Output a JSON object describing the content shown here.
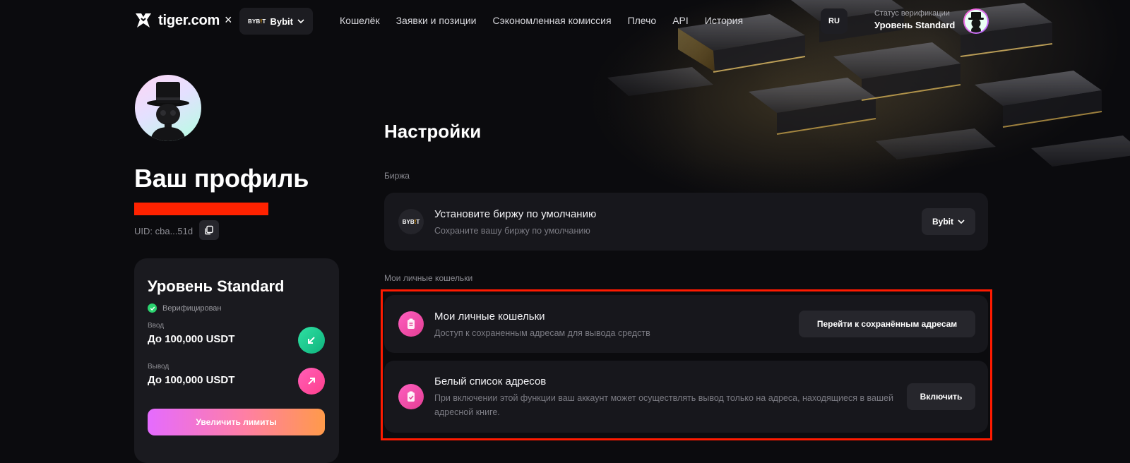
{
  "header": {
    "logo_text": "tiger.com",
    "separator": "×",
    "exchange": {
      "badge": "BYB!T",
      "label": "Bybit"
    },
    "nav": [
      "Кошелёк",
      "Заявки и позиции",
      "Сэкономленная комиссия",
      "Плечо",
      "API",
      "История"
    ],
    "language": "RU",
    "verification": {
      "label": "Статус верификации",
      "level": "Уровень Standard"
    }
  },
  "profile": {
    "title": "Ваш профиль",
    "uid": "UID: cba...51d",
    "level_card": {
      "title": "Уровень Standard",
      "status": "Верифицирован",
      "deposit_label": "Ввод",
      "deposit_value": "До 100,000 USDT",
      "withdraw_label": "Вывод",
      "withdraw_value": "До 100,000 USDT",
      "increase_button": "Увеличить лимиты"
    }
  },
  "settings": {
    "title": "Настройки",
    "exchange_section": {
      "label": "Биржа",
      "title": "Установите биржу по умолчанию",
      "subtitle": "Сохраните вашу биржу по умолчанию",
      "badge": "BYB!T",
      "button": "Bybit"
    },
    "wallets_section": {
      "label": "Мои личные кошельки",
      "wallets": {
        "title": "Мои личные кошельки",
        "subtitle": "Доступ к сохраненным адресам для вывода средств",
        "button": "Перейти к сохранённым адресам"
      },
      "whitelist": {
        "title": "Белый список адресов",
        "subtitle": "При включении этой функции ваш аккаунт может осуществлять вывод только на адреса, находящиеся в вашей адресной книге.",
        "button": "Включить"
      }
    }
  },
  "colors": {
    "background": "#0b0b0e",
    "card": "#17171c",
    "highlight": "#ff1a00",
    "deposit_icon": "#2fe1a3",
    "withdraw_icon": "#ff3f8c"
  },
  "icons": [
    "tiger-logo-icon",
    "chevron-down-icon",
    "copy-icon",
    "check-icon",
    "arrow-in-icon",
    "arrow-out-icon",
    "clipboard-icon",
    "clipboard-check-icon"
  ]
}
